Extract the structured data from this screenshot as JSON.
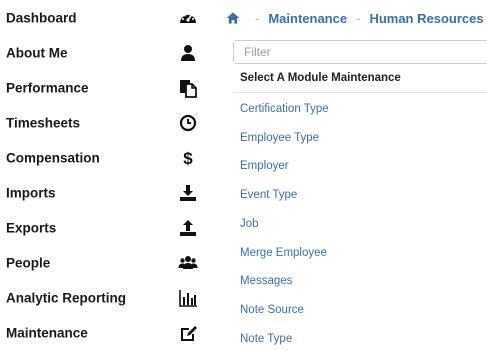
{
  "sidebar": {
    "items": [
      {
        "label": "Dashboard",
        "icon": "dashboard-icon"
      },
      {
        "label": "About Me",
        "icon": "user-icon"
      },
      {
        "label": "Performance",
        "icon": "copy-icon"
      },
      {
        "label": "Timesheets",
        "icon": "clock-icon"
      },
      {
        "label": "Compensation",
        "icon": "dollar-icon"
      },
      {
        "label": "Imports",
        "icon": "download-icon"
      },
      {
        "label": "Exports",
        "icon": "upload-icon"
      },
      {
        "label": "People",
        "icon": "users-icon"
      },
      {
        "label": "Analytic Reporting",
        "icon": "bar-chart-icon"
      },
      {
        "label": "Maintenance",
        "icon": "edit-icon"
      }
    ]
  },
  "breadcrumb": {
    "home_icon": "home-icon",
    "separator": "-",
    "items": [
      "Maintenance",
      "Human Resources"
    ]
  },
  "filter": {
    "placeholder": "Filter",
    "value": ""
  },
  "module_section": {
    "title": "Select A Module Maintenance"
  },
  "modules": [
    "Certification Type",
    "Employee Type",
    "Employer",
    "Event Type",
    "Job",
    "Merge Employee",
    "Messages",
    "Note Source",
    "Note Type"
  ],
  "colors": {
    "link": "#3a6fa6",
    "text": "#1a1a1a",
    "separator": "#b8b8b8"
  }
}
